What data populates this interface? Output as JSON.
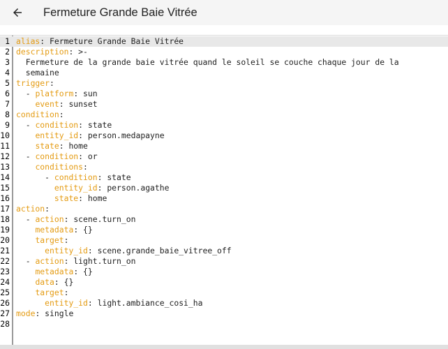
{
  "header": {
    "title": "Fermeture Grande Baie Vitrée",
    "back_icon": "arrow-left-icon"
  },
  "colors": {
    "key": "#e49b12",
    "value": "#212121",
    "gutter_border": "#9a9a9a",
    "active_line": "#e8e8e8",
    "header_bg": "#f5f5f5"
  },
  "editor": {
    "active_line": 1,
    "lines": [
      {
        "n": "1",
        "indent": "",
        "key": "alias",
        "sep": ": ",
        "val": "Fermeture Grande Baie Vitrée"
      },
      {
        "n": "2",
        "indent": "",
        "key": "description",
        "sep": ": ",
        "val": ">-"
      },
      {
        "n": "3",
        "indent": "  ",
        "key": "",
        "sep": "",
        "val": "Fermeture de la grande baie vitrée quand le soleil se couche chaque jour de la"
      },
      {
        "n": "4",
        "indent": "  ",
        "key": "",
        "sep": "",
        "val": "semaine"
      },
      {
        "n": "5",
        "indent": "",
        "key": "trigger",
        "sep": ":",
        "val": ""
      },
      {
        "n": "6",
        "indent": "  - ",
        "key": "platform",
        "sep": ": ",
        "val": "sun"
      },
      {
        "n": "7",
        "indent": "    ",
        "key": "event",
        "sep": ": ",
        "val": "sunset"
      },
      {
        "n": "8",
        "indent": "",
        "key": "condition",
        "sep": ":",
        "val": ""
      },
      {
        "n": "9",
        "indent": "  - ",
        "key": "condition",
        "sep": ": ",
        "val": "state"
      },
      {
        "n": "10",
        "indent": "    ",
        "key": "entity_id",
        "sep": ": ",
        "val": "person.medapayne"
      },
      {
        "n": "11",
        "indent": "    ",
        "key": "state",
        "sep": ": ",
        "val": "home"
      },
      {
        "n": "12",
        "indent": "  - ",
        "key": "condition",
        "sep": ": ",
        "val": "or"
      },
      {
        "n": "13",
        "indent": "    ",
        "key": "conditions",
        "sep": ":",
        "val": ""
      },
      {
        "n": "14",
        "indent": "      - ",
        "key": "condition",
        "sep": ": ",
        "val": "state"
      },
      {
        "n": "15",
        "indent": "        ",
        "key": "entity_id",
        "sep": ": ",
        "val": "person.agathe"
      },
      {
        "n": "16",
        "indent": "        ",
        "key": "state",
        "sep": ": ",
        "val": "home"
      },
      {
        "n": "17",
        "indent": "",
        "key": "action",
        "sep": ":",
        "val": ""
      },
      {
        "n": "18",
        "indent": "  - ",
        "key": "action",
        "sep": ": ",
        "val": "scene.turn_on"
      },
      {
        "n": "19",
        "indent": "    ",
        "key": "metadata",
        "sep": ": ",
        "val": "{}"
      },
      {
        "n": "20",
        "indent": "    ",
        "key": "target",
        "sep": ":",
        "val": ""
      },
      {
        "n": "21",
        "indent": "      ",
        "key": "entity_id",
        "sep": ": ",
        "val": "scene.grande_baie_vitree_off"
      },
      {
        "n": "22",
        "indent": "  - ",
        "key": "action",
        "sep": ": ",
        "val": "light.turn_on"
      },
      {
        "n": "23",
        "indent": "    ",
        "key": "metadata",
        "sep": ": ",
        "val": "{}"
      },
      {
        "n": "24",
        "indent": "    ",
        "key": "data",
        "sep": ": ",
        "val": "{}"
      },
      {
        "n": "25",
        "indent": "    ",
        "key": "target",
        "sep": ":",
        "val": ""
      },
      {
        "n": "26",
        "indent": "      ",
        "key": "entity_id",
        "sep": ": ",
        "val": "light.ambiance_cosi_ha"
      },
      {
        "n": "27",
        "indent": "",
        "key": "mode",
        "sep": ": ",
        "val": "single"
      },
      {
        "n": "28",
        "indent": "",
        "key": "",
        "sep": "",
        "val": ""
      }
    ]
  }
}
